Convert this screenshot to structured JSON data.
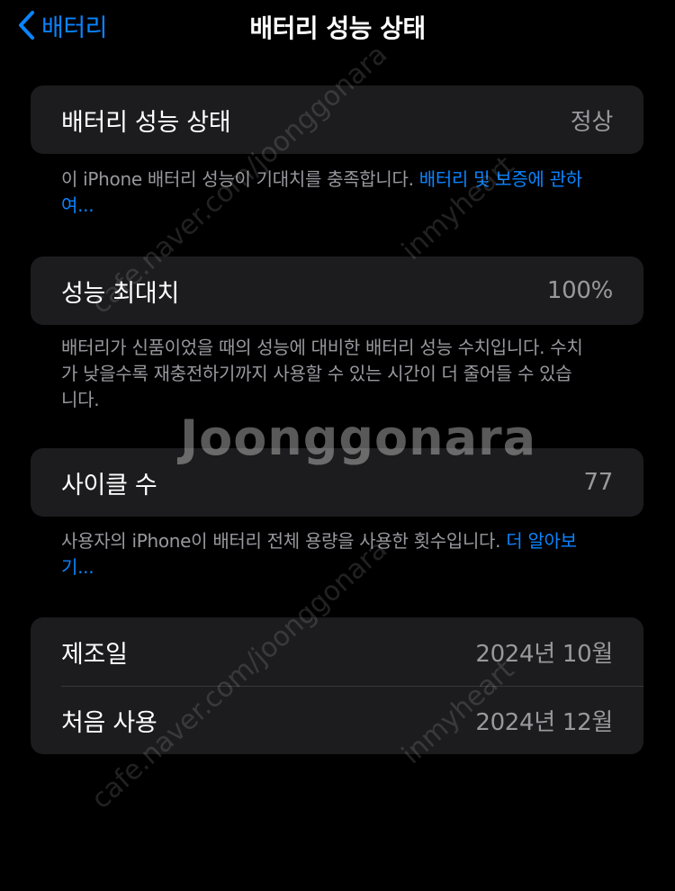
{
  "nav": {
    "back_label": "배터리",
    "title": "배터리 성능 상태"
  },
  "sections": {
    "health": {
      "label": "배터리 성능 상태",
      "value": "정상",
      "footer_text": "이 iPhone 배터리 성능이 기대치를 충족합니다. ",
      "footer_link": "배터리 및 보증에 관하여..."
    },
    "max_capacity": {
      "label": "성능 최대치",
      "value": "100%",
      "footer_text": "배터리가 신품이었을 때의 성능에 대비한 배터리 성능 수치입니다. 수치가 낮을수록 재충전하기까지 사용할 수 있는 시간이 더 줄어들 수 있습니다."
    },
    "cycle_count": {
      "label": "사이클 수",
      "value": "77",
      "footer_text": "사용자의 iPhone이 배터리 전체 용량을 사용한 횟수입니다. ",
      "footer_link": "더 알아보기..."
    },
    "dates": {
      "manufacture_label": "제조일",
      "manufacture_value": "2024년 10월",
      "first_use_label": "처음 사용",
      "first_use_value": "2024년 12월"
    }
  },
  "watermarks": {
    "main": "Joonggonara",
    "site": "cafe.naver.com/joonggonara",
    "user": "inmyheart"
  },
  "colors": {
    "background": "#000000",
    "cell": "#1c1c1e",
    "accent": "#0a84ff",
    "secondary_text": "#98989e"
  }
}
